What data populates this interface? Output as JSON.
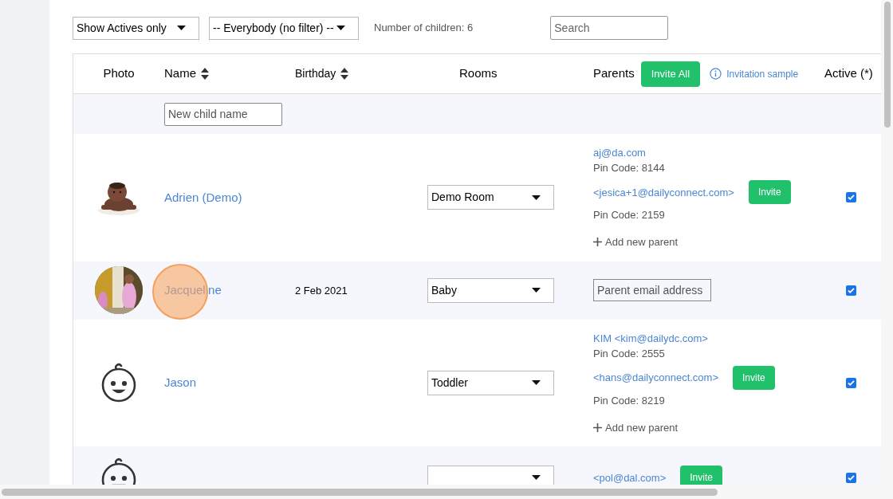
{
  "filters": {
    "status_select": "Show Actives only",
    "group_select": "-- Everybody (no filter) --",
    "count": "Number of children: 6",
    "search": {
      "placeholder": "Search"
    }
  },
  "table": {
    "columns": [
      {
        "label": "Photo",
        "sortable": false
      },
      {
        "label": "Name",
        "sortable": true
      },
      {
        "label": "Birthday",
        "sortable": true
      },
      {
        "label": "Rooms",
        "sortable": false
      },
      {
        "label": "Parents",
        "sortable": false
      },
      {
        "label": "Active (*)",
        "sortable": false
      }
    ],
    "invite_all": "Invite All",
    "invitation_sample": "Invitation sample",
    "new_child": {
      "placeholder": "New child name"
    },
    "rows": [
      {
        "name": "Adrien (Demo)",
        "birthday": "",
        "room": "Demo Room",
        "active": true,
        "parents": [
          {
            "email": "aj@da.com",
            "pin": "Pin Code: 8144"
          },
          {
            "email": "<jesica+1@dailyconnect.com>",
            "pin": "Pin Code: 2159",
            "invite": "Invite"
          }
        ],
        "add_parent": "Add new parent"
      },
      {
        "name": "Jacqueline",
        "birthday": "2 Feb 2021",
        "room": "Baby",
        "active": true,
        "parent_email": {
          "placeholder": "Parent email address"
        },
        "click_highlight": true
      },
      {
        "photo": {
          "kind": "icon"
        },
        "name": "Jason",
        "birthday": "",
        "room": "Toddler",
        "active": true,
        "parents": [
          {
            "email": "KIM <kim@dailydc.com>",
            "pin": "Pin Code: 2555"
          },
          {
            "email": "<hans@dailyconnect.com>",
            "pin": "Pin Code: 8219",
            "invite": "Invite"
          }
        ],
        "add_parent": "Add new parent"
      },
      {
        "photo": {
          "kind": "icon"
        },
        "name": "",
        "birthday": "",
        "room": "",
        "active": true,
        "parents": [
          {
            "email": "<pol@dal.com>",
            "invite": "Invite"
          }
        ]
      }
    ]
  }
}
